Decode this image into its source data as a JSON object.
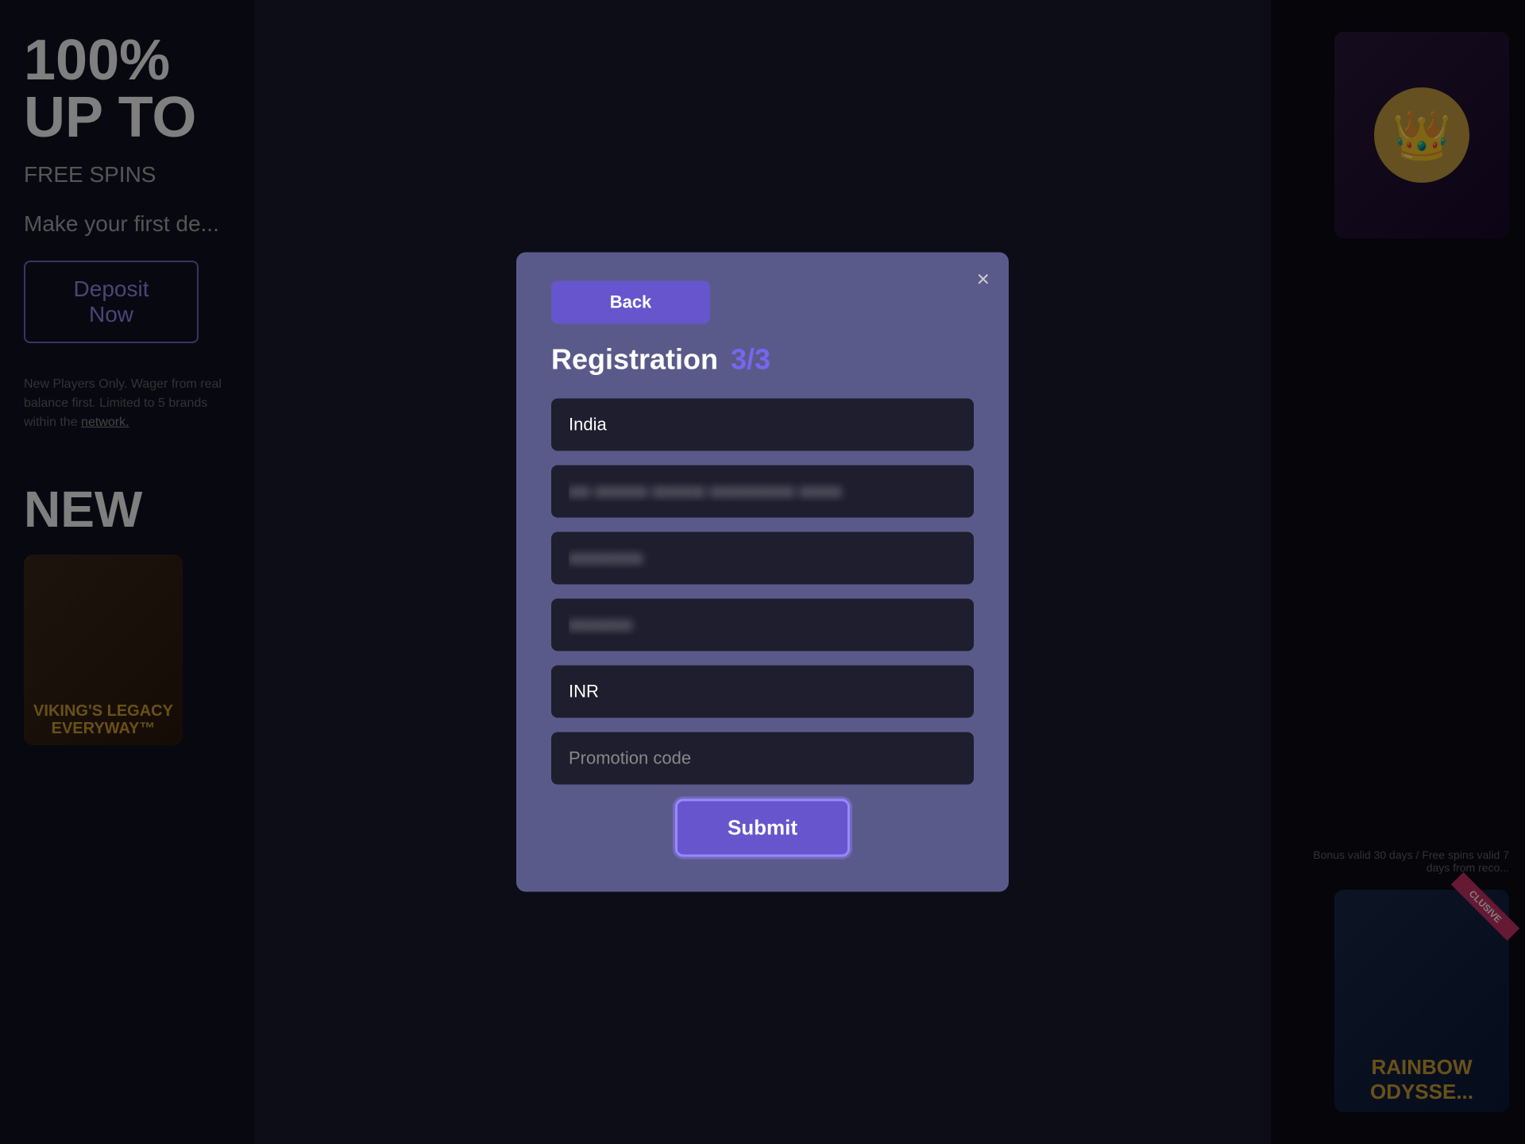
{
  "background": {
    "left": {
      "headline": "100% UP TO",
      "subheadline": "FREE SPINS",
      "make_deposit_text": "Make your first de...",
      "deposit_button_label": "Deposit Now",
      "small_print": "New Players Only. Wager from real balance first. Limited to 5 brands within the",
      "small_print_link": "network.",
      "new_label": "NEW",
      "viking_game": "VIKING'S LEGACY EVERYWAY™"
    },
    "right": {
      "bonus_note": "Bonus valid 30 days / Free spins valid 7 days from reco...",
      "rainbow_game": "RAINBOW ODYSSE...",
      "exclusive_label": "clusive"
    }
  },
  "modal": {
    "close_icon": "×",
    "back_button_label": "Back",
    "title": "Registration",
    "step": "3/3",
    "fields": {
      "country_value": "India",
      "address_placeholder": "Address (blurred)",
      "city_placeholder": "City (blurred)",
      "postal_placeholder": "Postal (blurred)",
      "currency_value": "INR",
      "promo_placeholder": "Promotion code"
    },
    "submit_label": "Submit"
  }
}
